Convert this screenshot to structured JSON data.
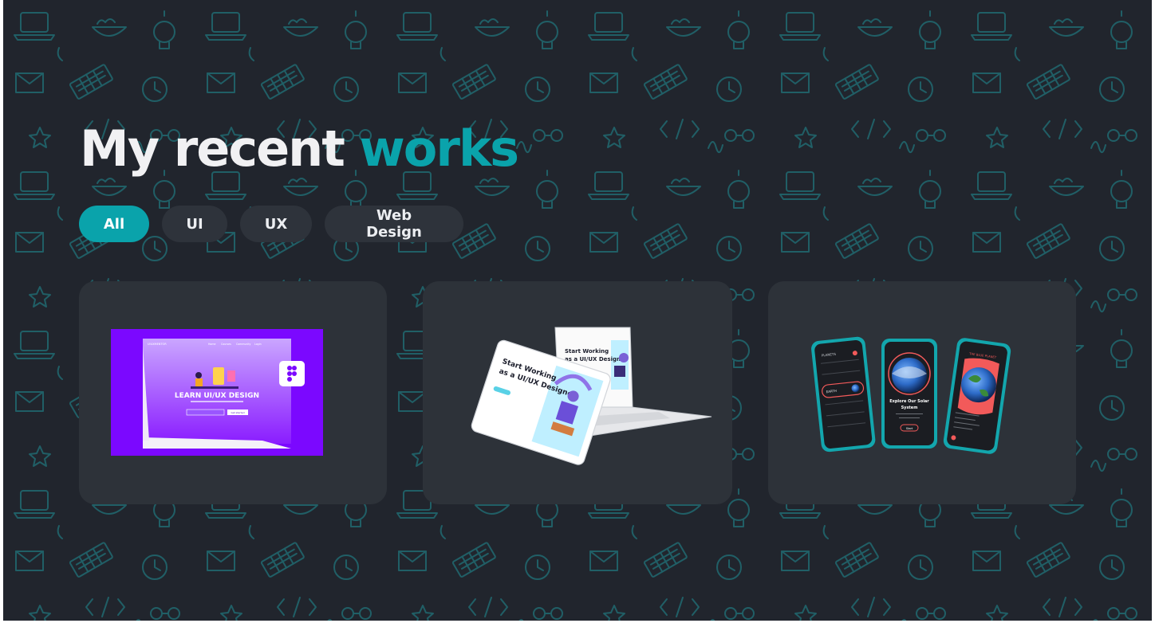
{
  "heading": {
    "prefix": "My recent",
    "accent": "works"
  },
  "filters": [
    {
      "label": "All",
      "active": true
    },
    {
      "label": "UI",
      "active": false
    },
    {
      "label": "UX",
      "active": false
    },
    {
      "label": "Web Design",
      "active": false
    }
  ],
  "projects": [
    {
      "headline": "LEARN UI/UX DESIGN",
      "brand": "UIUXMENTOR",
      "nav": [
        "Home",
        "Courses",
        "Community",
        "Login"
      ],
      "cta": "Get started",
      "icon": "figma-icon"
    },
    {
      "headline_line1": "Start Working",
      "headline_line2": "as a UI/UX Designer"
    },
    {
      "screen1_title": "PLANETS",
      "screen1_selected": "EARTH",
      "screen2_title_line1": "Explore Our Solar",
      "screen2_title_line2": "System",
      "screen2_button": "Start",
      "screen3_title": "THE BLUE PLANET"
    }
  ],
  "colors": {
    "background": "#21252d",
    "accent": "#0aa3ab",
    "card": "#2d3239",
    "chip": "#2e333b",
    "text": "#f1f1f3",
    "doodle": "#1f6870"
  }
}
